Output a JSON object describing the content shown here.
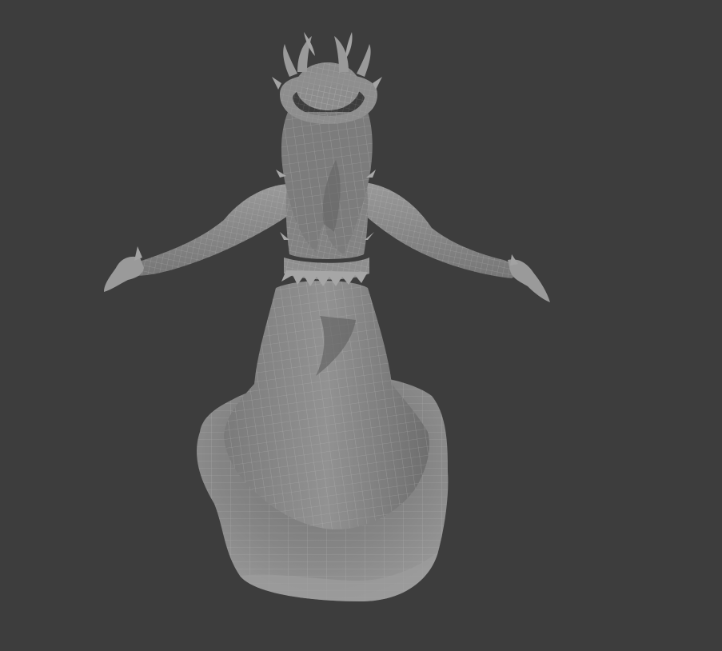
{
  "viewport": {
    "background_color": "#3d3d3d",
    "object_fill_color": "#8a8a8a",
    "wire_color": "#b8b8b8",
    "shadow_color": "#5a5a5a",
    "highlight_color": "#a8a8a8"
  }
}
